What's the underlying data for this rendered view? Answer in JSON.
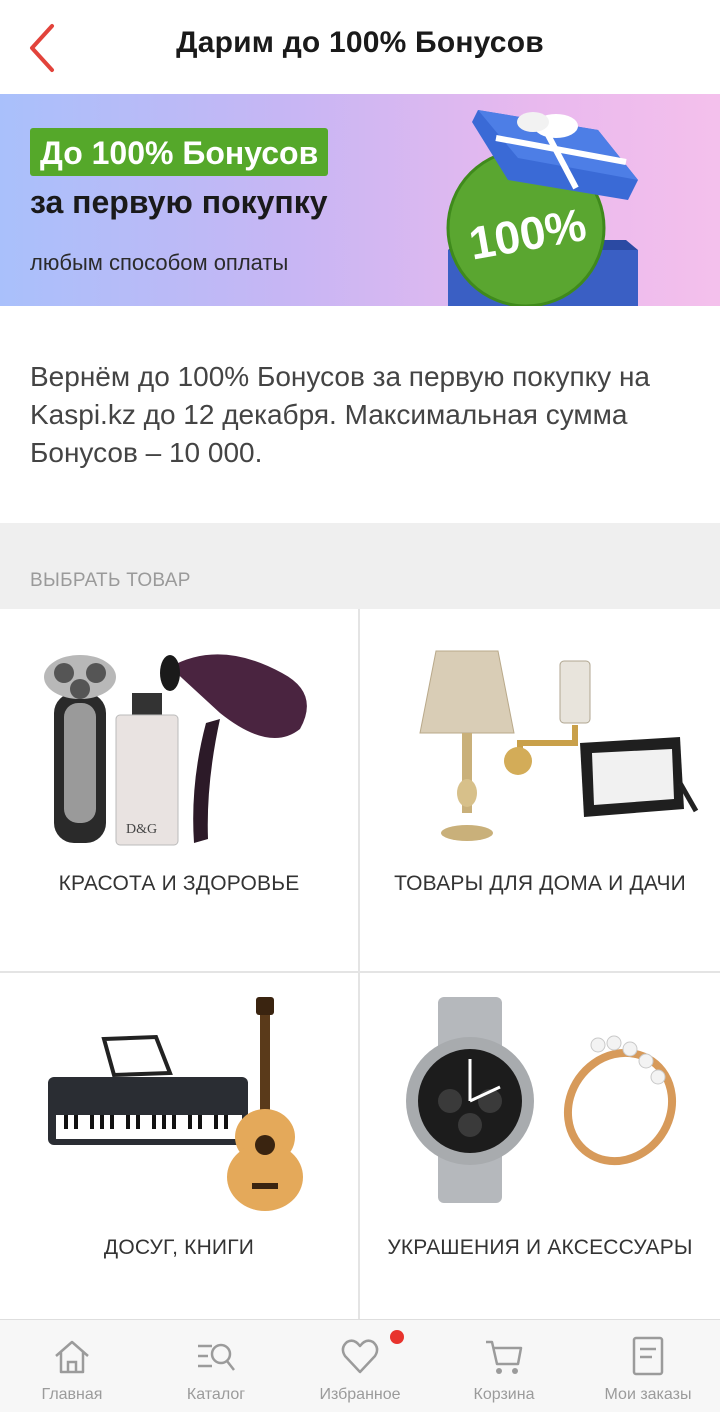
{
  "header": {
    "title": "Дарим до 100% Бонусов",
    "accent_color": "#e2433b"
  },
  "banner": {
    "badge": "До 100% Бонусов",
    "line2": "за первую покупку",
    "line3": "любым способом оплаты",
    "gift_text": "100%",
    "badge_color": "#55a82a"
  },
  "description": "Вернём до 100% Бонусов за первую покупку на Kaspi.kz до 12 декабря. Максимальная сумма Бонусов – 10 000.",
  "section": {
    "title": "ВЫБРАТЬ ТОВАР"
  },
  "categories": [
    {
      "label": "КРАСОТА И ЗДОРОВЬЕ",
      "icon": "shaver-perfume-hairdryer"
    },
    {
      "label": "ТОВАРЫ ДЛЯ ДОМА И ДАЧИ",
      "icon": "lamp-floodlight"
    },
    {
      "label": "ДОСУГ, КНИГИ",
      "icon": "synthesizer-guitar"
    },
    {
      "label": "УКРАШЕНИЯ И АКСЕССУАРЫ",
      "icon": "watch-ring"
    }
  ],
  "tabbar": {
    "items": [
      {
        "label": "Главная",
        "icon": "home-icon"
      },
      {
        "label": "Каталог",
        "icon": "catalog-search-icon"
      },
      {
        "label": "Избранное",
        "icon": "heart-icon"
      },
      {
        "label": "Корзина",
        "icon": "cart-icon"
      },
      {
        "label": "Мои заказы",
        "icon": "orders-icon"
      }
    ],
    "badge_color": "#e8332d"
  }
}
